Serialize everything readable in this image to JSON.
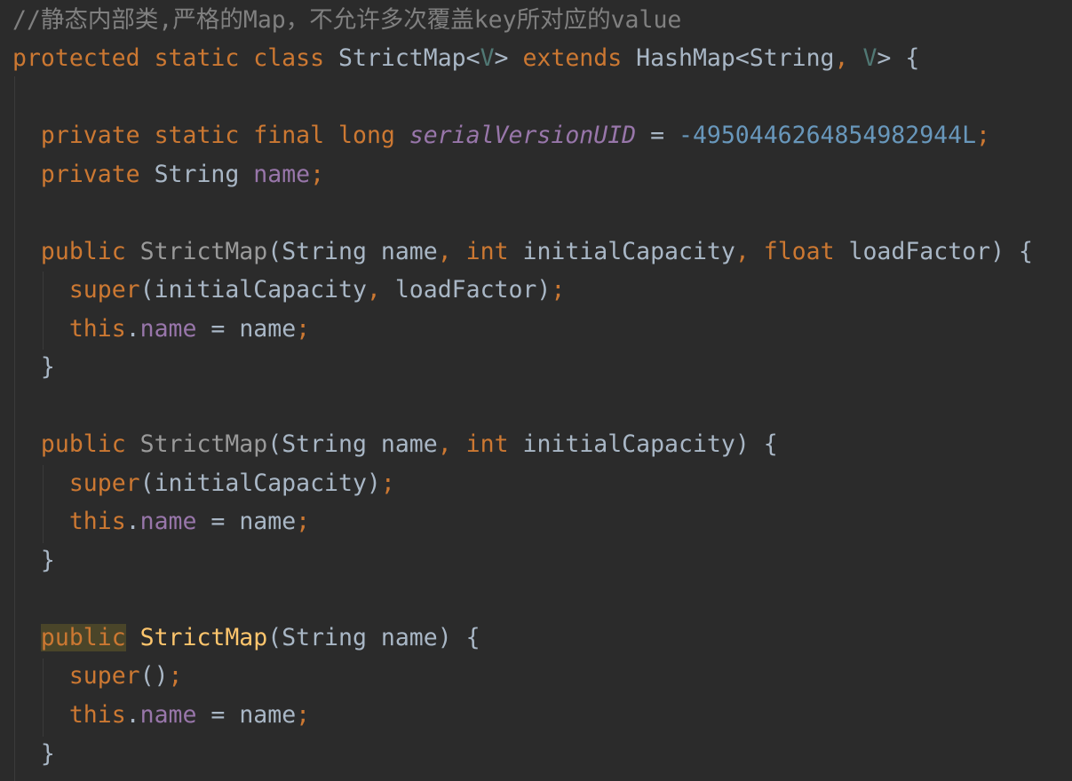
{
  "editor": {
    "comment": "//静态内部类,严格的Map，不允许多次覆盖key所对应的value",
    "kw_protected": "protected",
    "kw_static": "static",
    "kw_class": "class",
    "kw_extends": "extends",
    "kw_private": "private",
    "kw_final": "final",
    "kw_long": "long",
    "kw_public": "public",
    "kw_int": "int",
    "kw_float": "float",
    "kw_super": "super",
    "kw_this": "this",
    "class_name": "StrictMap",
    "type_param": "V",
    "type_string": "String",
    "type_hashmap": "HashMap",
    "field_serial": "serialVersionUID",
    "serial_value": "-4950446264854982944L",
    "field_name": "name",
    "param_name": "name",
    "param_initial_capacity": "initialCapacity",
    "param_load_factor": "loadFactor"
  }
}
